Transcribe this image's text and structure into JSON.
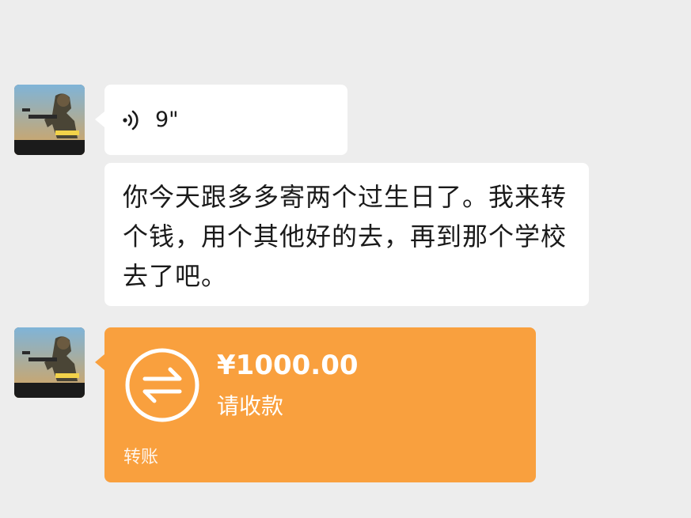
{
  "messages": {
    "voice": {
      "duration": "9\"",
      "icon": "voice-wave-icon"
    },
    "text": {
      "content": "你今天跟多多寄两个过生日了。我来转个钱，用个其他好的去，再到那个学校去了吧。"
    },
    "transfer": {
      "amount": "¥1000.00",
      "status": "请收款",
      "label": "转账",
      "icon": "transfer-arrows-icon",
      "color": "#f9a03e"
    }
  },
  "colors": {
    "background": "#ededed",
    "bubble": "#ffffff"
  }
}
